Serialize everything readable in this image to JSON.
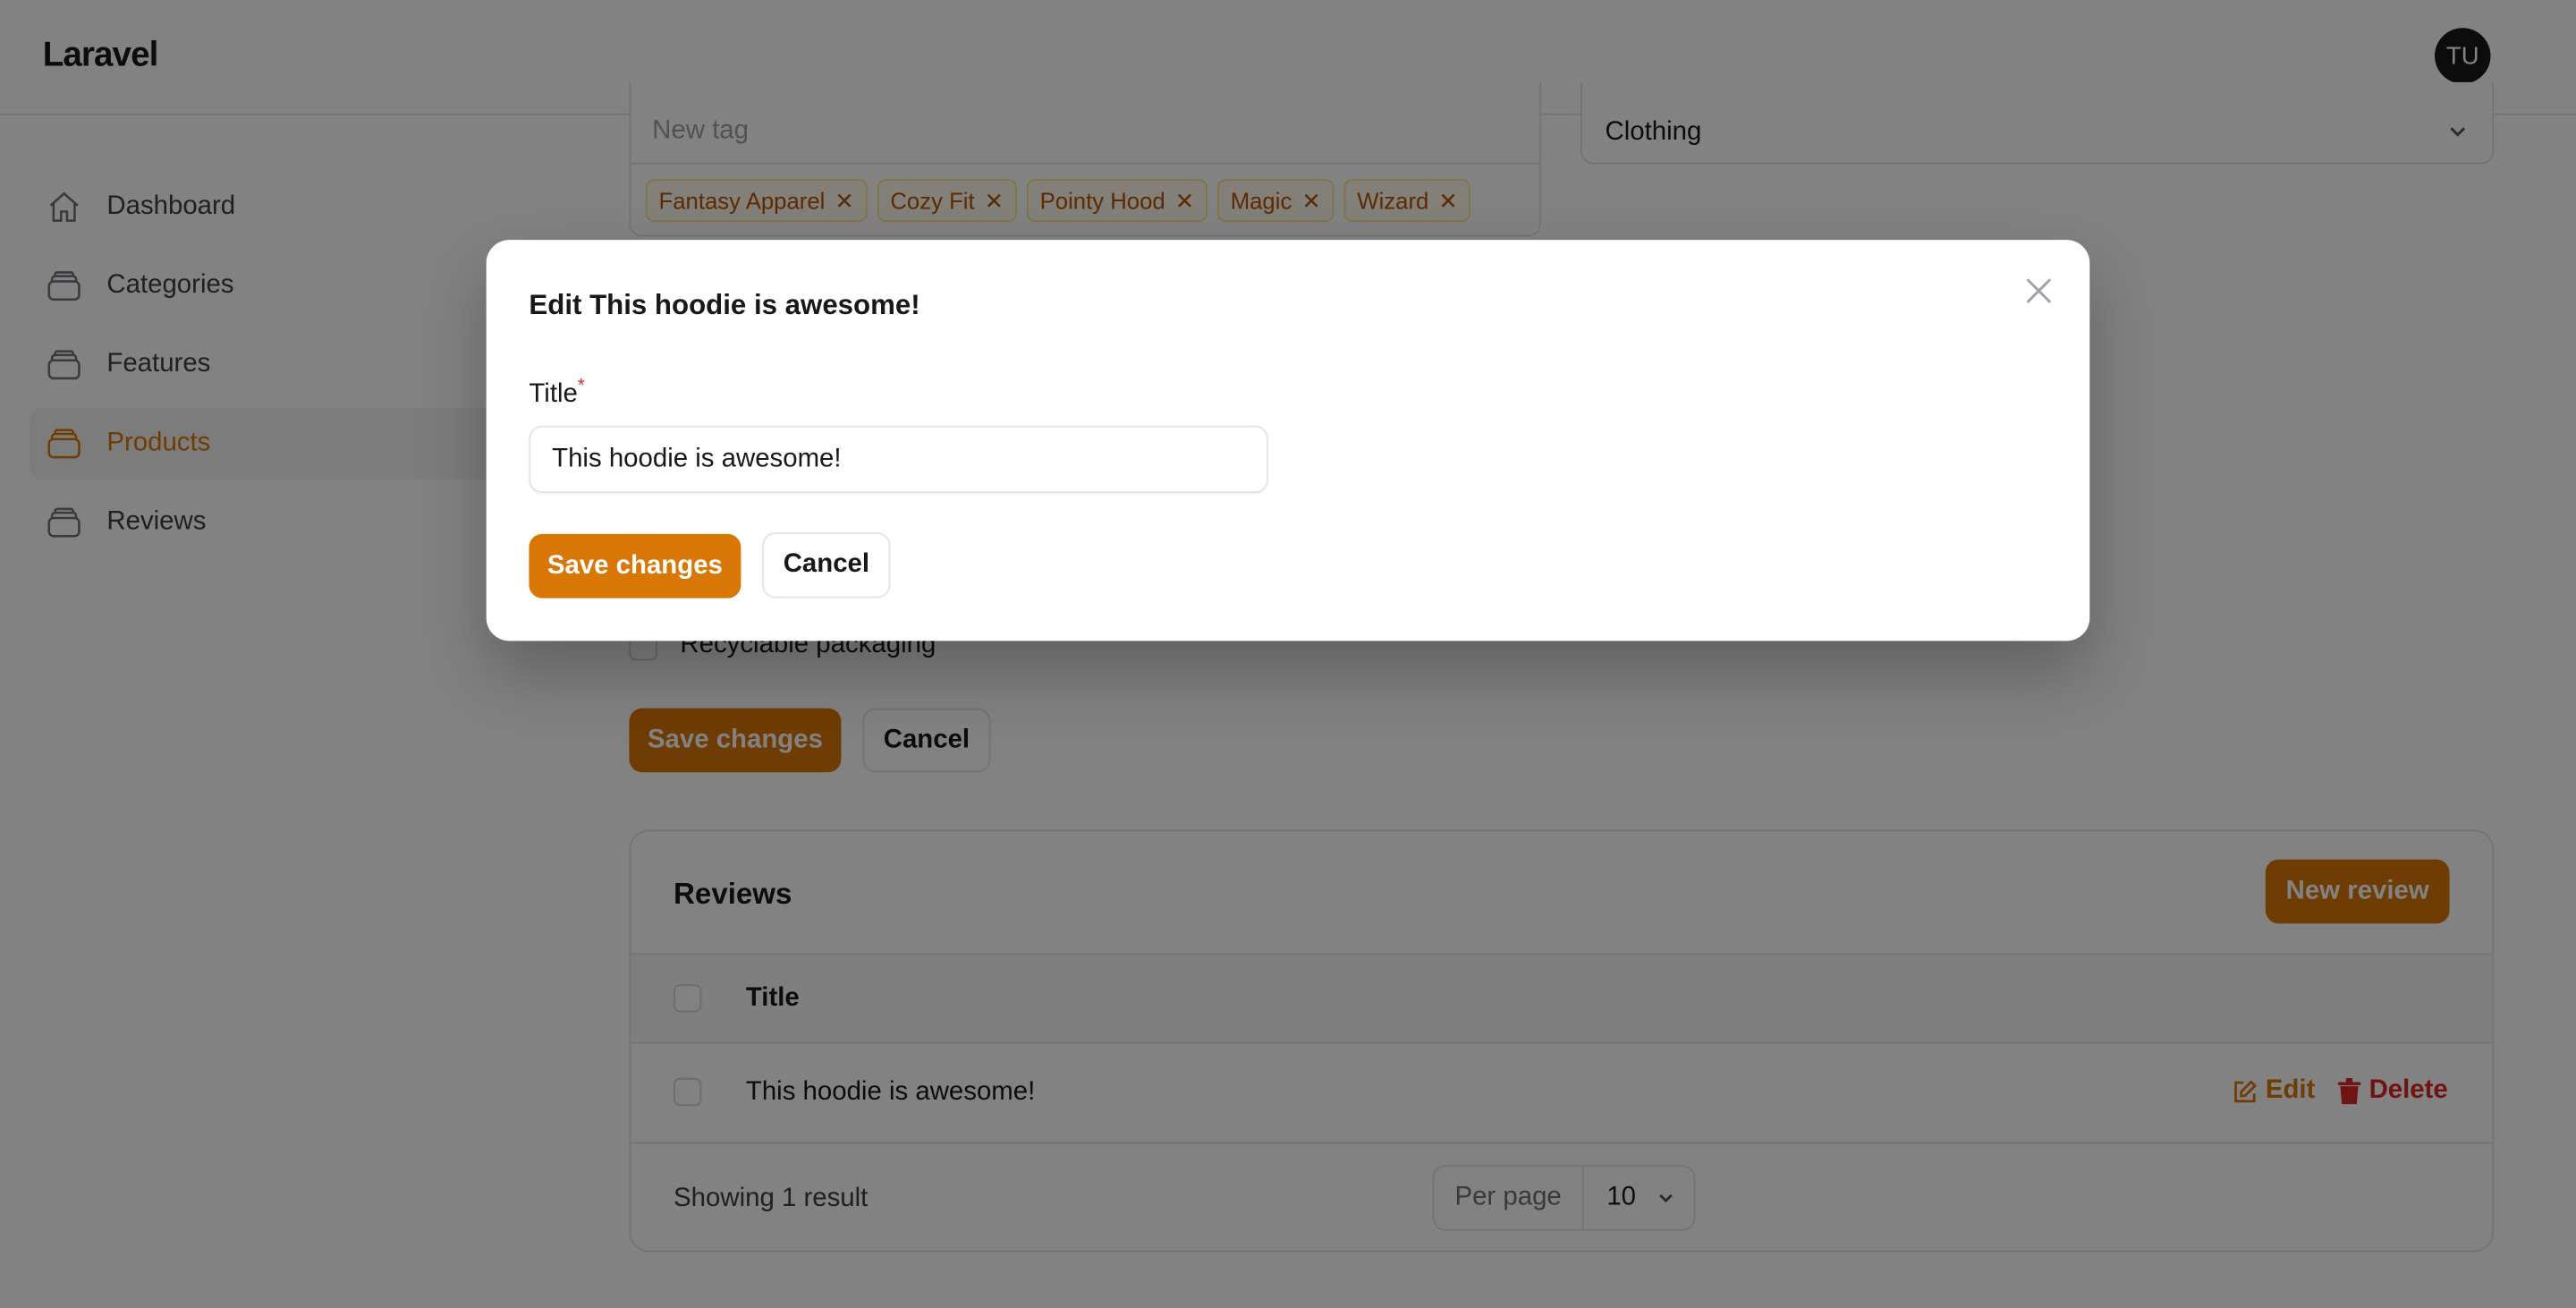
{
  "header": {
    "brand": "Laravel",
    "avatar_initials": "TU"
  },
  "sidebar": {
    "items": [
      {
        "label": "Dashboard",
        "icon": "home-icon",
        "active": false
      },
      {
        "label": "Categories",
        "icon": "stack-icon",
        "active": false
      },
      {
        "label": "Features",
        "icon": "stack-icon",
        "active": false
      },
      {
        "label": "Products",
        "icon": "stack-icon",
        "active": true
      },
      {
        "label": "Reviews",
        "icon": "stack-icon",
        "active": false
      }
    ]
  },
  "form": {
    "tag_placeholder": "New tag",
    "tags": [
      "Fantasy Apparel",
      "Cozy Fit",
      "Pointy Hood",
      "Magic",
      "Wizard"
    ],
    "category_value": "Clothing",
    "feature_label": "Recyclable packaging",
    "save_label": "Save changes",
    "cancel_label": "Cancel"
  },
  "reviews": {
    "title": "Reviews",
    "new_label": "New review",
    "column_title": "Title",
    "rows": [
      {
        "title": "This hoodie is awesome!",
        "edit": "Edit",
        "delete": "Delete"
      }
    ],
    "summary": "Showing 1 result",
    "per_page_label": "Per page",
    "per_page_value": "10"
  },
  "modal": {
    "heading": "Edit This hoodie is awesome!",
    "field_label": "Title",
    "required_mark": "*",
    "field_value": "This hoodie is awesome!",
    "save_label": "Save changes",
    "cancel_label": "Cancel"
  },
  "colors": {
    "accent": "#d97706",
    "danger": "#dc2626",
    "overlay": "rgba(0,0,0,0.5)"
  }
}
